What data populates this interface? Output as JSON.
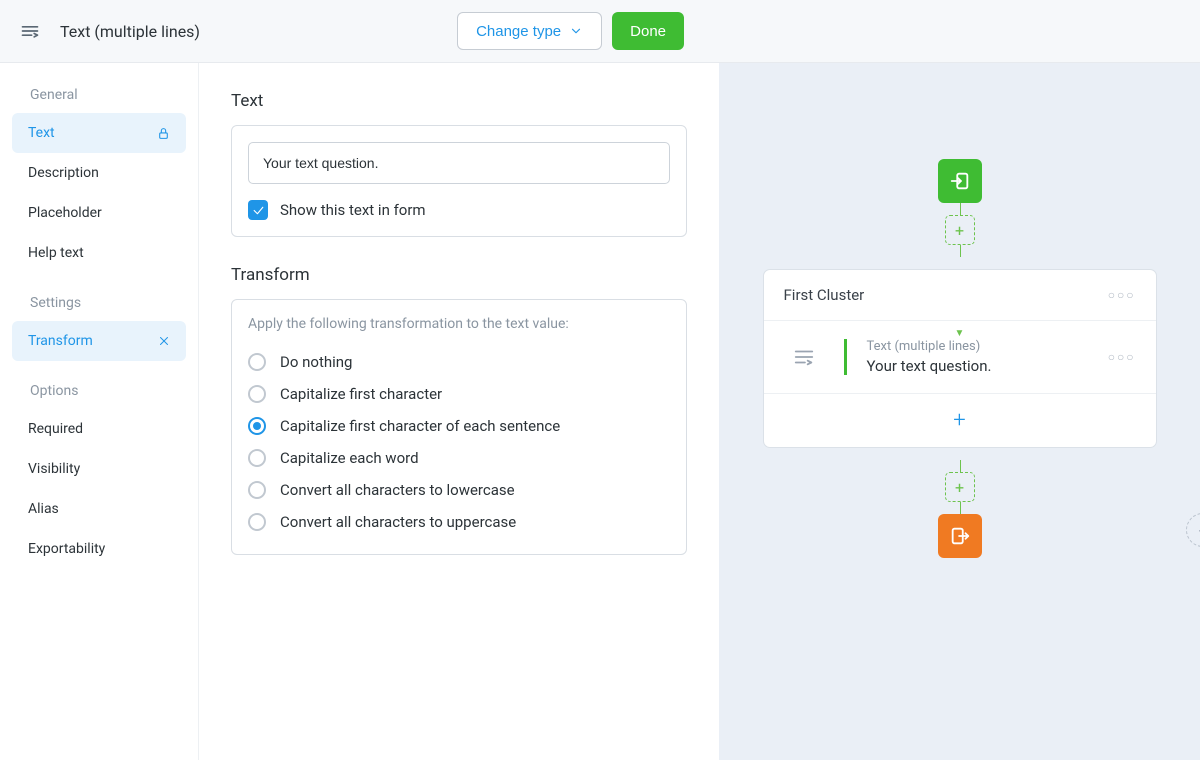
{
  "header": {
    "title": "Text (multiple lines)",
    "change_type": "Change type",
    "done": "Done"
  },
  "sidebar": {
    "groups": [
      {
        "title": "General",
        "items": [
          {
            "label": "Text",
            "active": true,
            "locked": true
          },
          {
            "label": "Description"
          },
          {
            "label": "Placeholder"
          },
          {
            "label": "Help text"
          }
        ]
      },
      {
        "title": "Settings",
        "items": [
          {
            "label": "Transform",
            "active": true,
            "close": true
          }
        ]
      },
      {
        "title": "Options",
        "items": [
          {
            "label": "Required"
          },
          {
            "label": "Visibility"
          },
          {
            "label": "Alias"
          },
          {
            "label": "Exportability"
          }
        ]
      }
    ]
  },
  "text_section": {
    "title": "Text",
    "value": "Your text question.",
    "show_in_form_label": "Show this text in form",
    "show_in_form_checked": true
  },
  "transform_section": {
    "title": "Transform",
    "help": "Apply the following transformation to the text value:",
    "options": [
      "Do nothing",
      "Capitalize first character",
      "Capitalize first character of each sentence",
      "Capitalize each word",
      "Convert all characters to lowercase",
      "Convert all characters to uppercase"
    ],
    "selected_index": 2
  },
  "preview": {
    "cluster_title": "First Cluster",
    "field_type": "Text (multiple lines)",
    "field_text": "Your text question."
  }
}
